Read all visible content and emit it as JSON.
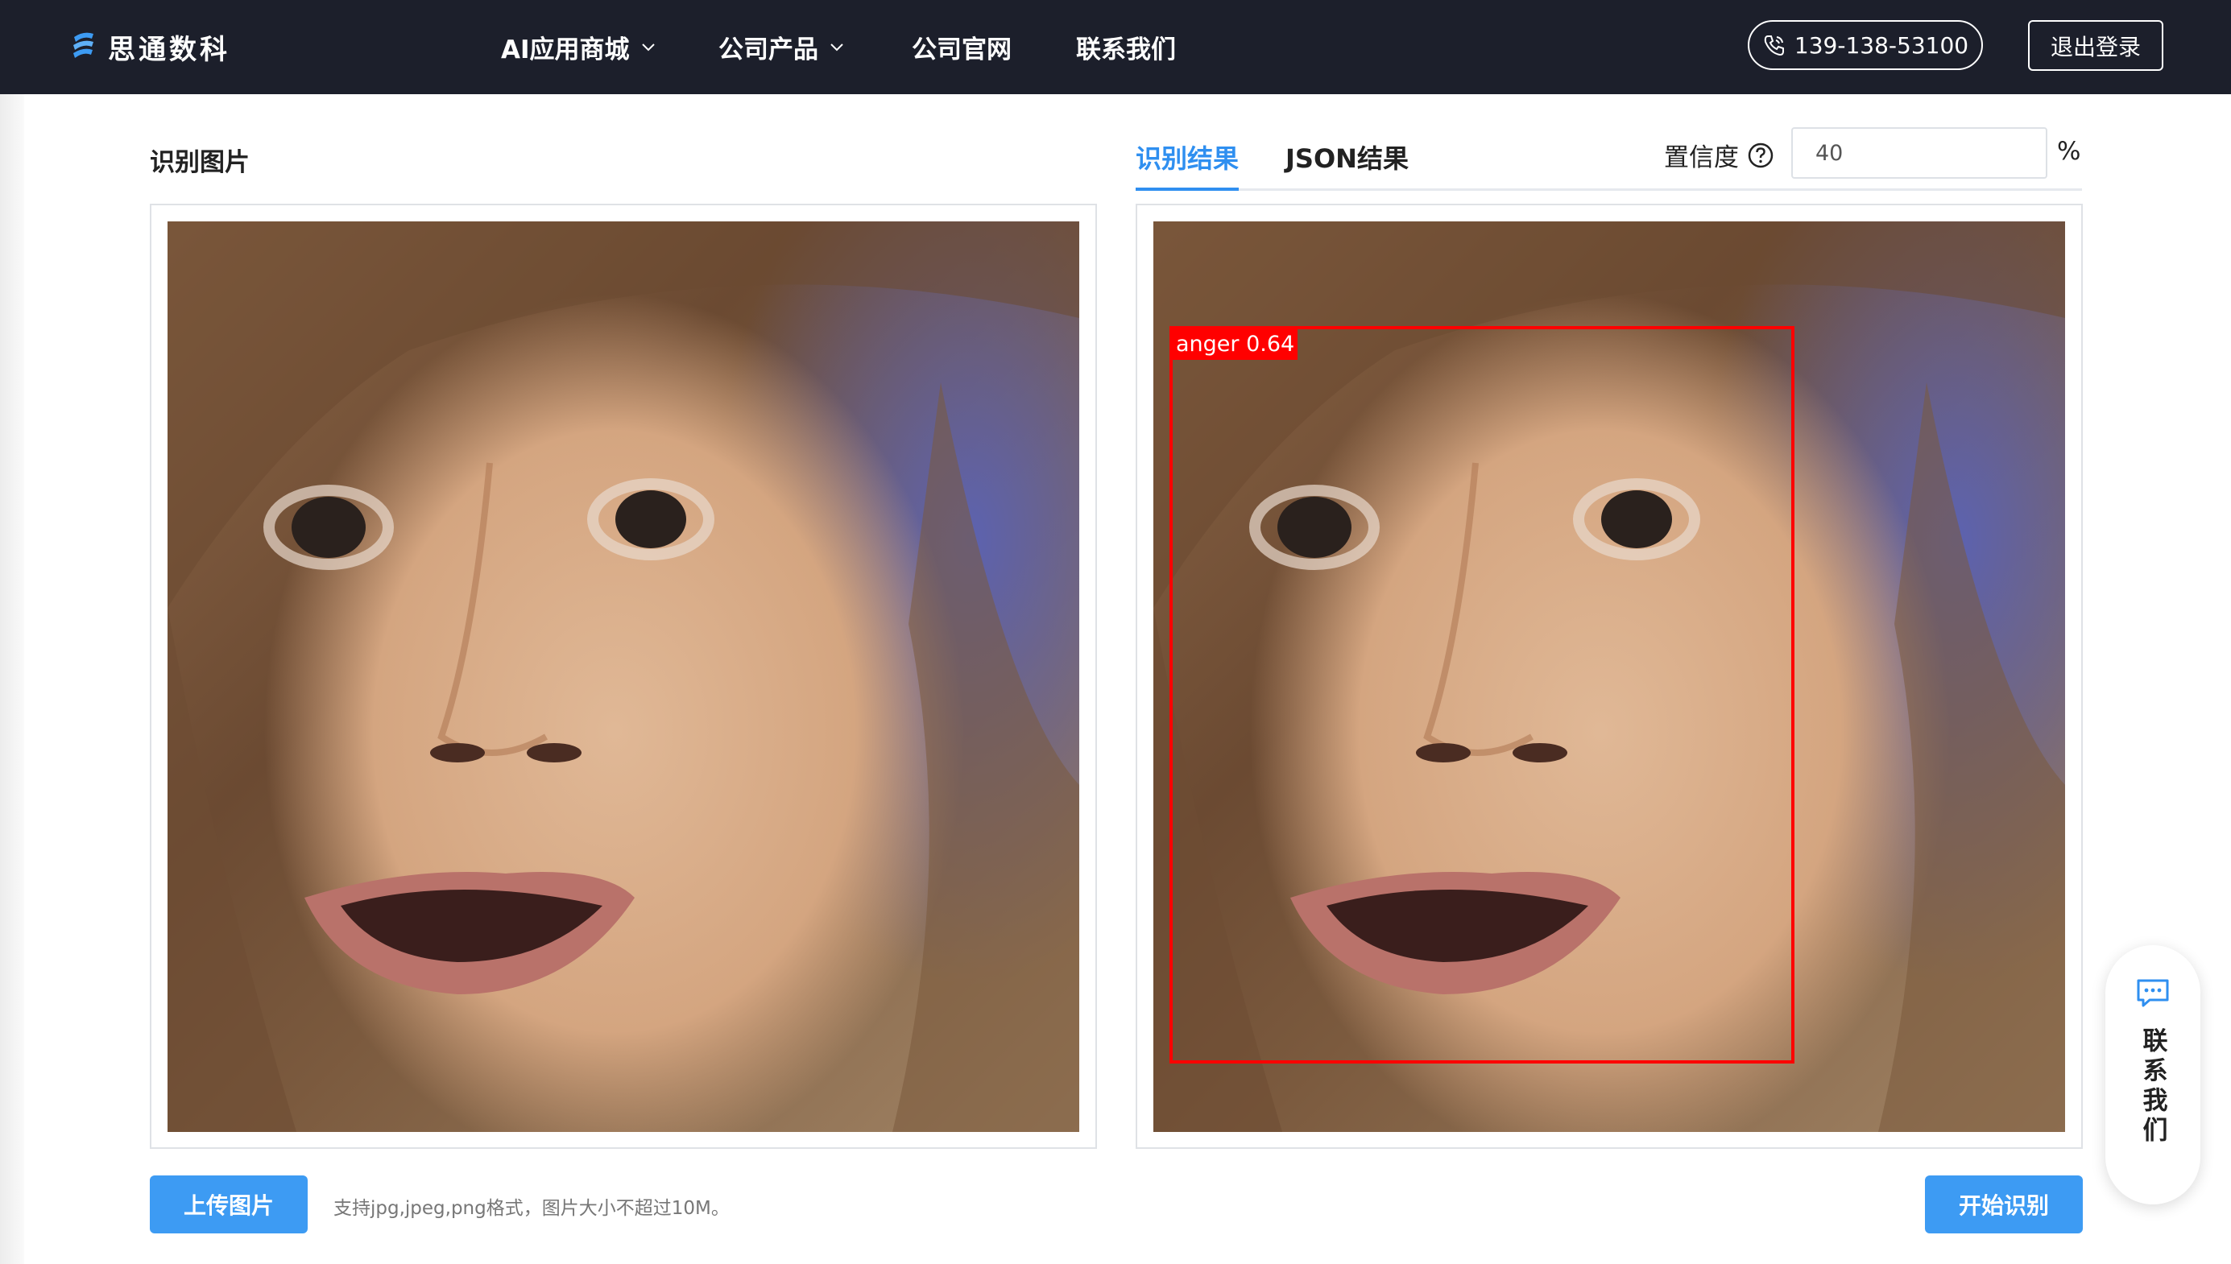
{
  "nav": {
    "brand": "思通数科",
    "items": [
      {
        "label": "AI应用商城",
        "has_dropdown": true
      },
      {
        "label": "公司产品",
        "has_dropdown": true
      },
      {
        "label": "公司官网",
        "has_dropdown": false
      },
      {
        "label": "联系我们",
        "has_dropdown": false
      }
    ],
    "phone": "139-138-53100",
    "logout": "退出登录"
  },
  "left": {
    "title": "识别图片"
  },
  "right": {
    "tabs": [
      {
        "label": "识别结果",
        "active": true
      },
      {
        "label": "JSON结果",
        "active": false
      }
    ],
    "confidence_label": "置信度",
    "confidence_value": "40",
    "confidence_unit": "%",
    "detection": {
      "label": "anger 0.64"
    }
  },
  "footer": {
    "upload_button": "上传图片",
    "hint": "支持jpg,jpeg,png格式，图片大小不超过10M。",
    "start_button": "开始识别"
  },
  "float_contact": {
    "label": "联系我们"
  },
  "colors": {
    "nav_bg": "#1c1f2b",
    "primary": "#3d9bf3",
    "tab_active": "#2f8ff0",
    "detection_box": "#ff0000"
  }
}
